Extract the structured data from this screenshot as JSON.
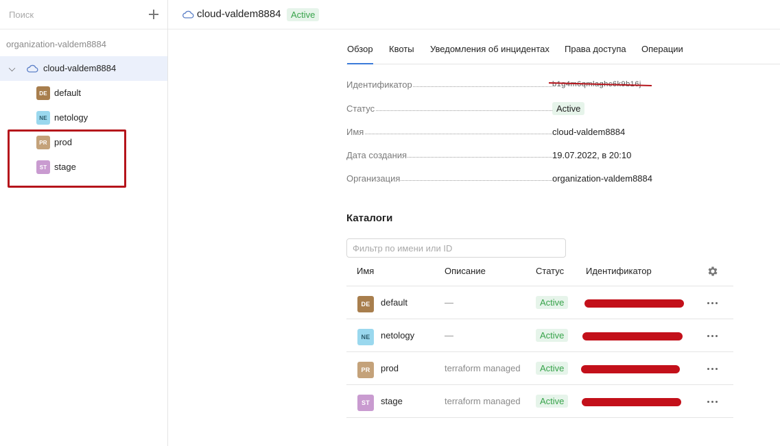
{
  "sidebar": {
    "search_placeholder": "Поиск",
    "organization": "organization-valdem8884",
    "cloud": {
      "label": "cloud-valdem8884",
      "icon": "cloud-icon"
    },
    "folders": [
      {
        "badge": "DE",
        "label": "default",
        "color": "#a87e4d"
      },
      {
        "badge": "NE",
        "label": "netology",
        "color": "#9ad8ee"
      },
      {
        "badge": "PR",
        "label": "prod",
        "color": "#c4a27a"
      },
      {
        "badge": "ST",
        "label": "stage",
        "color": "#c99bd0"
      }
    ]
  },
  "header": {
    "title": "cloud-valdem8884",
    "status": "Active"
  },
  "tabs": [
    "Обзор",
    "Квоты",
    "Уведомления об инцидентах",
    "Права доступа",
    "Операции"
  ],
  "info": {
    "id_label": "Идентификатор",
    "id_value": "b1g4m6qmlaghc6k9b16j",
    "status_label": "Статус",
    "status_value": "Active",
    "name_label": "Имя",
    "name_value": "cloud-valdem8884",
    "created_label": "Дата создания",
    "created_value": "19.07.2022, в 20:10",
    "org_label": "Организация",
    "org_value": "organization-valdem8884"
  },
  "catalogs": {
    "title": "Каталоги",
    "filter_placeholder": "Фильтр по имени или ID",
    "columns": [
      "Имя",
      "Описание",
      "Статус",
      "Идентификатор"
    ],
    "rows": [
      {
        "badge": "DE",
        "name": "default",
        "description": "—",
        "status": "Active",
        "color": "#a87e4d"
      },
      {
        "badge": "NE",
        "name": "netology",
        "description": "—",
        "status": "Active",
        "color": "#9ad8ee"
      },
      {
        "badge": "PR",
        "name": "prod",
        "description": "terraform managed",
        "status": "Active",
        "color": "#c4a27a"
      },
      {
        "badge": "ST",
        "name": "stage",
        "description": "terraform managed",
        "status": "Active",
        "color": "#c99bd0"
      }
    ]
  },
  "colors": {
    "accent": "#3a7ad9",
    "status_bg": "#e6f4ea",
    "status_fg": "#37a34a",
    "redaction": "#c3101a"
  }
}
